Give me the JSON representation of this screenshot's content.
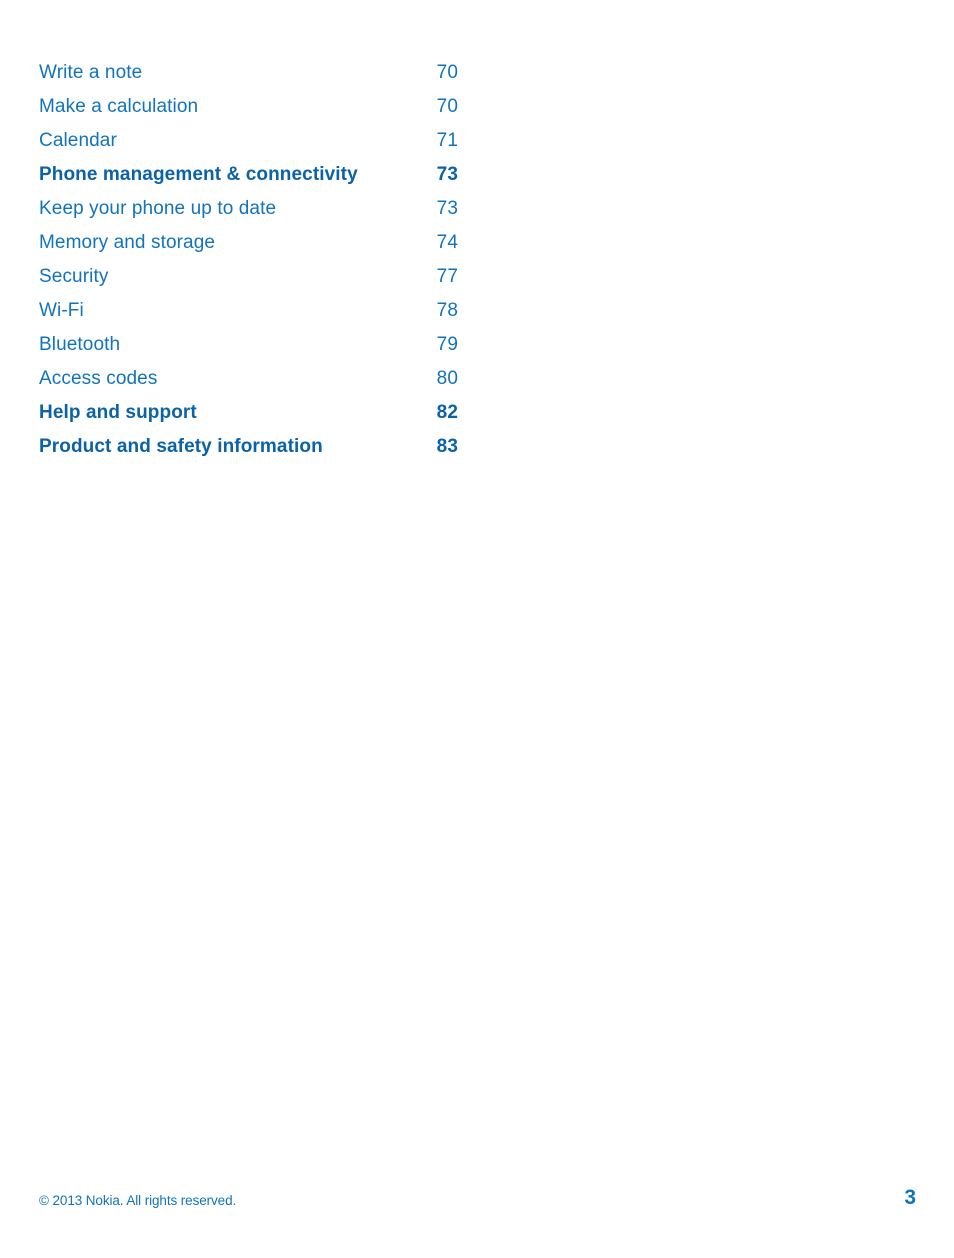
{
  "document": {
    "type": "table-of-contents",
    "page_number": "3",
    "text_color": "#1273BD",
    "heading_color": "#0B62A8",
    "background_color": "#FFFFFF"
  },
  "toc": {
    "entries": [
      {
        "title": "Write a note",
        "page": "70",
        "level": 2
      },
      {
        "title": "Make a calculation",
        "page": "70",
        "level": 2
      },
      {
        "title": "Calendar",
        "page": "71",
        "level": 2
      },
      {
        "title": "Phone management & connectivity",
        "page": "73",
        "level": 1
      },
      {
        "title": "Keep your phone up to date",
        "page": "73",
        "level": 2
      },
      {
        "title": "Memory and storage",
        "page": "74",
        "level": 2
      },
      {
        "title": "Security",
        "page": "77",
        "level": 2
      },
      {
        "title": "Wi-Fi",
        "page": "78",
        "level": 2
      },
      {
        "title": "Bluetooth",
        "page": "79",
        "level": 2
      },
      {
        "title": "Access codes",
        "page": "80",
        "level": 2
      },
      {
        "title": "Help and support",
        "page": "82",
        "level": 1
      },
      {
        "title": "Product and safety information",
        "page": "83",
        "level": 1
      }
    ]
  },
  "footer": {
    "copyright": "© 2013 Nokia. All rights reserved.",
    "page_number": "3"
  }
}
